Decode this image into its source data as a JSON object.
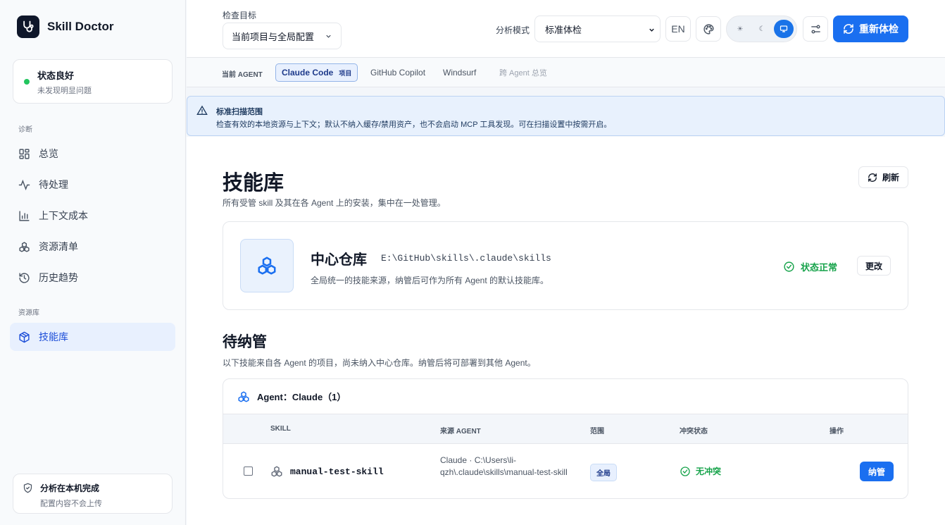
{
  "brand": {
    "name": "Skill Doctor"
  },
  "status": {
    "title": "状态良好",
    "subtitle": "未发现明显问题",
    "color": "#22c55e"
  },
  "nav": {
    "section_diagnose": "诊断",
    "items": [
      {
        "label": "总览",
        "icon": "grid-icon"
      },
      {
        "label": "待处理",
        "icon": "activity-icon"
      },
      {
        "label": "上下文成本",
        "icon": "bar-chart-icon"
      },
      {
        "label": "资源清单",
        "icon": "boxes-icon"
      },
      {
        "label": "历史趋势",
        "icon": "history-icon"
      }
    ],
    "section_library": "资源库",
    "library_items": [
      {
        "label": "技能库",
        "icon": "package-icon",
        "active": true
      }
    ]
  },
  "footer_card": {
    "title": "分析在本机完成",
    "subtitle": "配置内容不会上传"
  },
  "topbar": {
    "target_label": "检查目标",
    "target_value": "当前项目与全局配置",
    "mode_label": "分析模式",
    "mode_value": "标准体检",
    "lang_button": "EN",
    "theme_options": [
      "light",
      "dark",
      "system"
    ],
    "theme_selected": "system",
    "primary_button": "重新体检",
    "accent_color": "#1a6ff0"
  },
  "agentbar": {
    "label": "当前 AGENT",
    "tabs": [
      {
        "label": "Claude Code",
        "tag": "项目",
        "active": true
      },
      {
        "label": "GitHub Copilot"
      },
      {
        "label": "Windsurf"
      },
      {
        "label": "跨 Agent 总览",
        "muted": true
      }
    ]
  },
  "notice": {
    "title": "标准扫描范围",
    "text": "检查有效的本地资源与上下文；默认不纳入缓存/禁用资产，也不会启动 MCP 工具发现。可在扫描设置中按需开启。"
  },
  "page": {
    "title": "技能库",
    "subtitle": "所有受管 skill 及其在各 Agent 上的安装，集中在一处管理。",
    "refresh_label": "刷新"
  },
  "repo": {
    "title": "中心仓库",
    "path": "E:\\GitHub\\skills\\.claude\\skills",
    "description": "全局统一的技能来源，纳管后可作为所有 Agent 的默认技能库。",
    "status": "状态正常",
    "change_label": "更改"
  },
  "pending": {
    "title": "待纳管",
    "subtitle": "以下技能来自各 Agent 的项目，尚未纳入中心仓库。纳管后将可部署到其他 Agent。",
    "group_title": "Agent：Claude（1）",
    "columns": [
      "SKILL",
      "来源 AGENT",
      "范围",
      "冲突状态",
      "操作"
    ],
    "rows": [
      {
        "skill": "manual-test-skill",
        "source": "Claude · C:\\Users\\li-qzh\\.claude\\skills\\manual-test-skill",
        "scope": "全局",
        "conflict": "无冲突",
        "action": "纳管"
      }
    ]
  }
}
